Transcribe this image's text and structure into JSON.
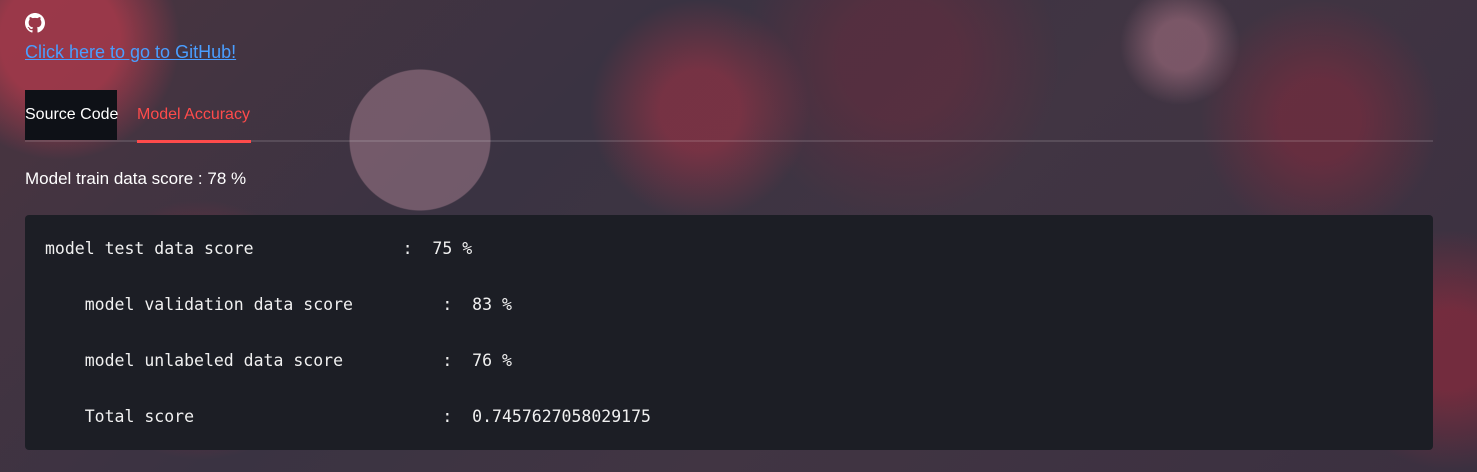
{
  "header": {
    "github_icon": "github-icon",
    "github_link_text": "Click here to go to GitHub!"
  },
  "tabs": [
    {
      "label": "Source Code",
      "selected": false
    },
    {
      "label": "Model Accuracy",
      "selected": true
    }
  ],
  "accuracy": {
    "train_score_text": "Model train data score : 78 %",
    "code_lines": [
      "model test data score               :  75 %",
      "    model validation data score         :  83 %",
      "    model unlabeled data score          :  76 %",
      "    Total score                         :  0.7457627058029175"
    ]
  },
  "colors": {
    "accent": "#ff4b4b",
    "link": "#4a9eff",
    "code_background": "#1c1e25",
    "tab_background": "#0e1117"
  }
}
